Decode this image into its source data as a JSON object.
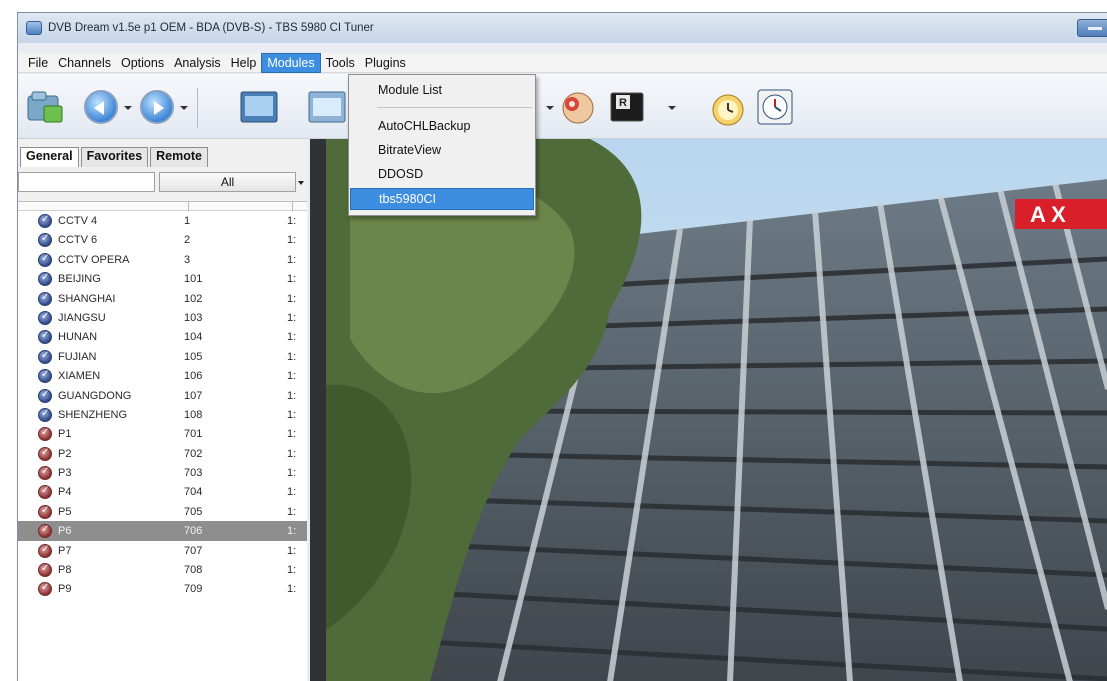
{
  "window": {
    "title": "DVB Dream v1.5e p1 OEM - BDA (DVB-S) - TBS 5980 CI Tuner"
  },
  "menubar": {
    "items": [
      "File",
      "Channels",
      "Options",
      "Analysis",
      "Help",
      "Modules",
      "Tools",
      "Plugins"
    ],
    "active": "Modules"
  },
  "modules_menu": {
    "items": [
      "Module List",
      "AutoCHLBackup",
      "BitrateView",
      "DDOSD",
      "tbs5980CI"
    ],
    "highlighted": "tbs5980CI"
  },
  "tabs": [
    "General",
    "Favorites",
    "Remote"
  ],
  "filter": {
    "value": "",
    "selected": "All"
  },
  "channels": [
    {
      "name": "CCTV 4",
      "number": "1",
      "extra": "1:",
      "icon": "tv-channel-icon",
      "color": "blue"
    },
    {
      "name": "CCTV 6",
      "number": "2",
      "extra": "1:",
      "icon": "tv-channel-icon",
      "color": "blue"
    },
    {
      "name": "CCTV OPERA",
      "number": "3",
      "extra": "1:",
      "icon": "tv-channel-icon",
      "color": "blue"
    },
    {
      "name": "BEIJING",
      "number": "101",
      "extra": "1:",
      "icon": "tv-channel-icon",
      "color": "blue"
    },
    {
      "name": "SHANGHAI",
      "number": "102",
      "extra": "1:",
      "icon": "tv-channel-icon",
      "color": "blue"
    },
    {
      "name": "JIANGSU",
      "number": "103",
      "extra": "1:",
      "icon": "tv-channel-icon",
      "color": "blue"
    },
    {
      "name": "HUNAN",
      "number": "104",
      "extra": "1:",
      "icon": "tv-channel-icon",
      "color": "blue"
    },
    {
      "name": "FUJIAN",
      "number": "105",
      "extra": "1:",
      "icon": "tv-channel-icon",
      "color": "blue"
    },
    {
      "name": "XIAMEN",
      "number": "106",
      "extra": "1:",
      "icon": "tv-channel-icon",
      "color": "blue"
    },
    {
      "name": "GUANGDONG",
      "number": "107",
      "extra": "1:",
      "icon": "tv-channel-icon",
      "color": "blue"
    },
    {
      "name": "SHENZHENG",
      "number": "108",
      "extra": "1:",
      "icon": "tv-channel-icon",
      "color": "blue"
    },
    {
      "name": "P1",
      "number": "701",
      "extra": "1:",
      "icon": "tv-channel-icon",
      "color": "red"
    },
    {
      "name": "P2",
      "number": "702",
      "extra": "1:",
      "icon": "tv-channel-icon",
      "color": "red"
    },
    {
      "name": "P3",
      "number": "703",
      "extra": "1:",
      "icon": "tv-channel-icon",
      "color": "red"
    },
    {
      "name": "P4",
      "number": "704",
      "extra": "1:",
      "icon": "tv-channel-icon",
      "color": "red"
    },
    {
      "name": "P5",
      "number": "705",
      "extra": "1:",
      "icon": "tv-channel-icon",
      "color": "red"
    },
    {
      "name": "P6",
      "number": "706",
      "extra": "1:",
      "icon": "tv-channel-icon",
      "color": "red",
      "selected": true
    },
    {
      "name": "P7",
      "number": "707",
      "extra": "1:",
      "icon": "tv-channel-icon",
      "color": "red"
    },
    {
      "name": "P8",
      "number": "708",
      "extra": "1:",
      "icon": "tv-channel-icon",
      "color": "red"
    },
    {
      "name": "P9",
      "number": "709",
      "extra": "1:",
      "icon": "tv-channel-icon",
      "color": "red"
    }
  ],
  "video": {
    "sign_text": "A X"
  },
  "colors": {
    "menu_highlight": "#3d8ee0",
    "selected_row": "#8e8e8e",
    "sign_red": "#d9202a"
  }
}
